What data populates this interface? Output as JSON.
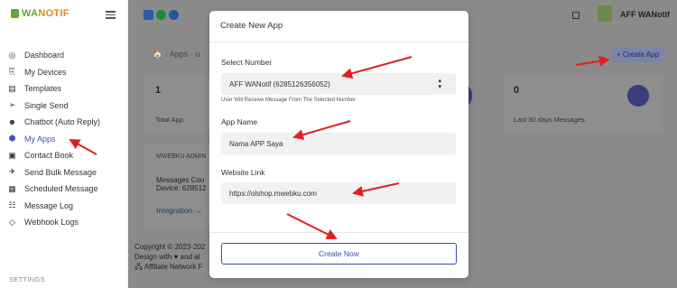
{
  "brand": {
    "name_prefix": "WA",
    "name_suffix": "NOTIF"
  },
  "sidebar": {
    "items": [
      {
        "label": "Dashboard",
        "icon": "dashboard-icon",
        "glyph": "◎"
      },
      {
        "label": "My Devices",
        "icon": "devices-icon",
        "glyph": "⎘"
      },
      {
        "label": "Templates",
        "icon": "templates-icon",
        "glyph": "▤"
      },
      {
        "label": "Single Send",
        "icon": "send-icon",
        "glyph": "➢"
      },
      {
        "label": "Chatbot (Auto Reply)",
        "icon": "chatbot-icon",
        "glyph": "☻"
      },
      {
        "label": "My Apps",
        "icon": "apps-icon",
        "glyph": "⬢",
        "active": true
      },
      {
        "label": "Contact Book",
        "icon": "contact-book-icon",
        "glyph": "▣"
      },
      {
        "label": "Send Bulk Message",
        "icon": "bulk-send-icon",
        "glyph": "✈"
      },
      {
        "label": "Scheduled Message",
        "icon": "calendar-icon",
        "glyph": "▦"
      },
      {
        "label": "Message Log",
        "icon": "log-icon",
        "glyph": "☷"
      },
      {
        "label": "Webhook Logs",
        "icon": "webhook-icon",
        "glyph": "◇"
      }
    ],
    "settings_label": "SETTINGS"
  },
  "topbar": {
    "user_name": "AFF WANotif"
  },
  "page": {
    "breadcrumb": "🏠 ·  Apps  ·  u",
    "create_button": "+ Create App",
    "stat_left": {
      "value": "1",
      "caption": "Total App"
    },
    "stat_right": {
      "value": "0",
      "caption": "Last 30 days Messages"
    },
    "app_card": {
      "name": "MWEBKU ADMIN",
      "line1": "Messages Cou",
      "line2": "Device: 628512",
      "link": "Integration →"
    },
    "footer": {
      "line1": "Copyright © 2023-202",
      "line2": "Design with ♥ and al",
      "line3": "🖧 Affiliate Network F"
    }
  },
  "modal": {
    "title": "Create New App",
    "select_label": "Select Number",
    "select_value": "AFF WANotif (6285126356052)",
    "select_hint": "User Will Receive Message From The Selected Number",
    "app_name_label": "App Name",
    "app_name_value": "Nama APP Saya",
    "website_label": "Website Link",
    "website_value": "https://olshop.mwebku.com",
    "submit_label": "Create Now"
  },
  "colors": {
    "accent": "#3a4cb5",
    "annotation_arrow": "#e02020",
    "brand_green": "#5fa83a"
  }
}
